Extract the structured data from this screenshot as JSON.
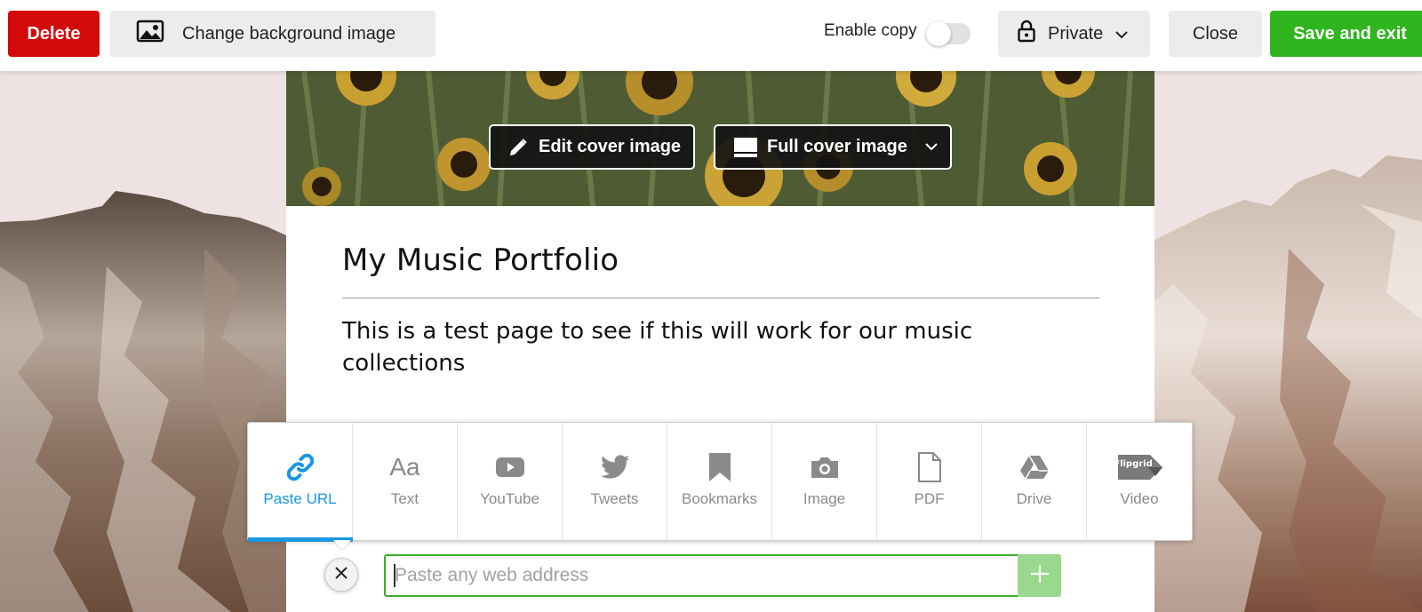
{
  "toolbar": {
    "delete_label": "Delete",
    "change_bg_label": "Change background image",
    "enable_copy_label": "Enable copy",
    "enable_copy_on": false,
    "privacy_label": "Private",
    "close_label": "Close",
    "save_label": "Save and exit",
    "delete_color": "#d40a0a",
    "save_color": "#2fb51e"
  },
  "cover": {
    "edit_label": "Edit cover image",
    "full_label": "Full cover image"
  },
  "page": {
    "title": "My Music Portfolio",
    "description": "This is a test page to see if this will work for our music collections"
  },
  "picker": {
    "accent_color": "#1797e6",
    "items": [
      {
        "label": "Paste URL",
        "icon": "link-icon",
        "active": true
      },
      {
        "label": "Text",
        "icon": "text-icon",
        "active": false
      },
      {
        "label": "YouTube",
        "icon": "youtube-icon",
        "active": false
      },
      {
        "label": "Tweets",
        "icon": "twitter-icon",
        "active": false
      },
      {
        "label": "Bookmarks",
        "icon": "bookmark-icon",
        "active": false
      },
      {
        "label": "Image",
        "icon": "camera-icon",
        "active": false
      },
      {
        "label": "PDF",
        "icon": "pdf-icon",
        "active": false
      },
      {
        "label": "Drive",
        "icon": "drive-icon",
        "active": false
      },
      {
        "label": "Video",
        "icon": "flipgrid-icon",
        "active": false
      }
    ],
    "text_icon_glyph": "Aa",
    "flipgrid_text": "Flipgrid"
  },
  "url_input": {
    "placeholder": "Paste any web address",
    "value": ""
  }
}
